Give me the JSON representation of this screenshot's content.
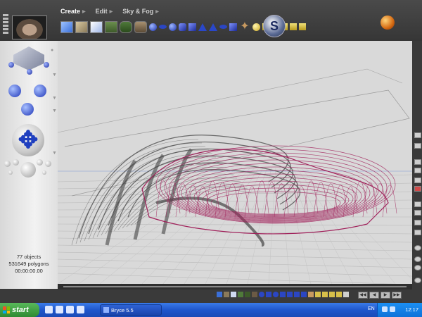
{
  "app": {
    "title": "Bryce 5.5"
  },
  "menus": [
    {
      "label": "Create",
      "active": true
    },
    {
      "label": "Edit",
      "active": false
    },
    {
      "label": "Sky & Fog",
      "active": false
    }
  ],
  "stats": {
    "objects": "77 objects",
    "polygons": "531649 polygons",
    "time": "00:00:00.00"
  },
  "taskbar": {
    "start_label": "start",
    "task_label": "Bryce 5.5",
    "language": "EN",
    "clock": "12:17"
  },
  "colors": {
    "wire_gray": "#555555",
    "wire_magenta": "#a0205a",
    "viewport_bg": "#d9d9d9"
  }
}
